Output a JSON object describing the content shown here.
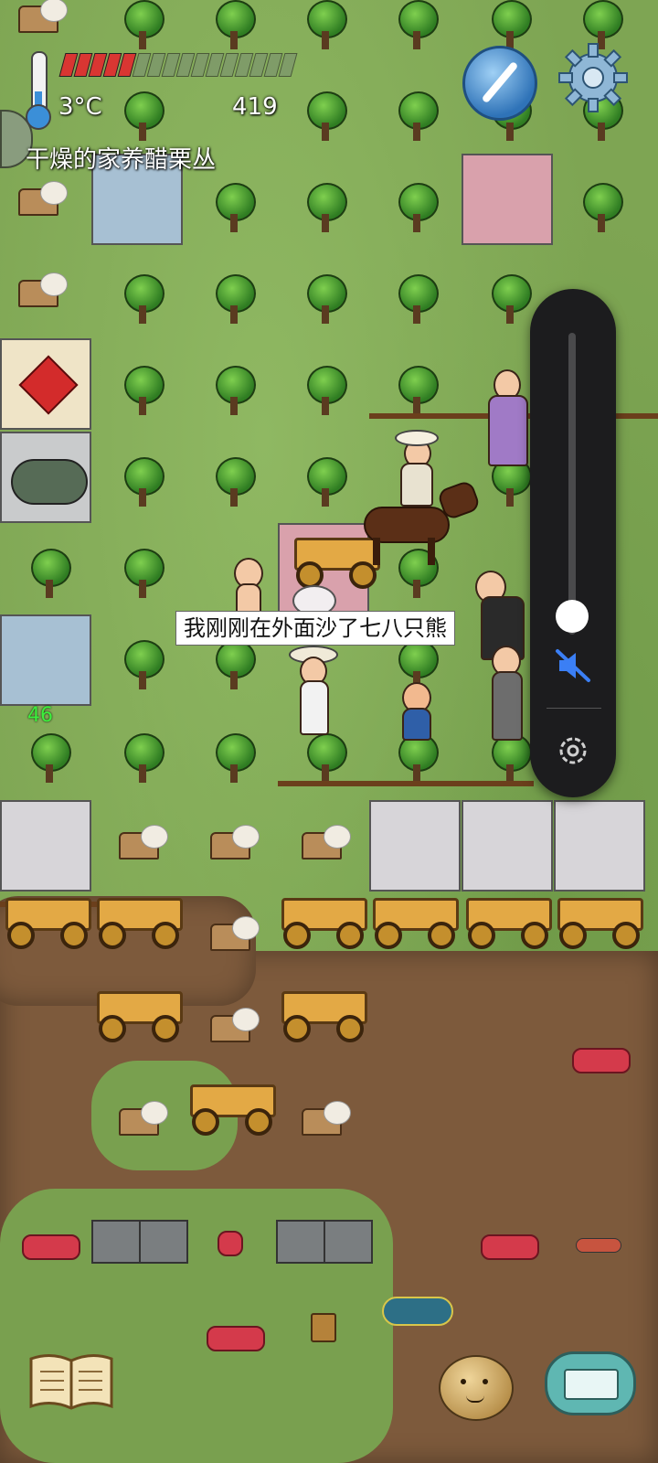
{
  "hud": {
    "temperature": "3°C",
    "age": "419",
    "object_label": "干燥的家养醋栗丛",
    "food_bar": {
      "filled": 5,
      "total": 16
    },
    "side_number": "46"
  },
  "speech": {
    "text": "我刚刚在外面沙了七八只熊"
  },
  "volume_panel": {
    "level": 0.1,
    "muted": true
  },
  "icons": {
    "thermometer": "thermometer-icon",
    "compass": "compass-icon",
    "settings": "gear-icon",
    "mute": "speaker-muted-icon",
    "volume_settings": "settings-icon",
    "book": "book-icon",
    "potato": "potato-emote-icon",
    "keyboard": "keyboard-icon"
  },
  "colors": {
    "grass": "#7ea553",
    "dirt": "#7d5a3c",
    "food_full": "#d93632",
    "side_number": "#3cf03c"
  }
}
